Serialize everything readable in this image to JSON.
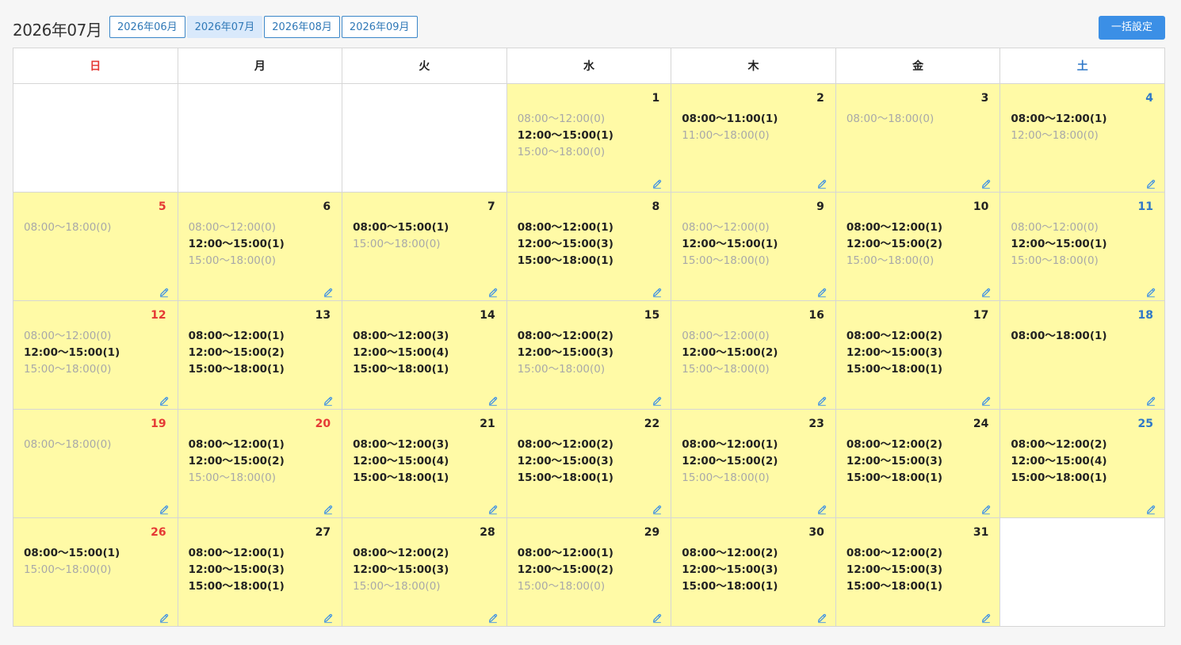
{
  "header": {
    "title": "2026年07月",
    "tabs": [
      {
        "label": "2026年06月",
        "active": false
      },
      {
        "label": "2026年07月",
        "active": true
      },
      {
        "label": "2026年08月",
        "active": false
      },
      {
        "label": "2026年09月",
        "active": false
      }
    ],
    "bulk_button": "一括設定"
  },
  "colors": {
    "day_bg": "#fffaa6",
    "sunday": "#e53935",
    "saturday": "#2f78c8",
    "button": "#3b8fe6",
    "available_text": "#222222",
    "unavailable_text": "#a8a8a8"
  },
  "weekdays": [
    "日",
    "月",
    "火",
    "水",
    "木",
    "金",
    "土"
  ],
  "icons": {
    "edit": "pencil-icon"
  },
  "weeks": [
    [
      null,
      null,
      null,
      {
        "day": "1",
        "slots": [
          {
            "time": "08:00〜12:00(0)",
            "on": false
          },
          {
            "time": "12:00〜15:00(1)",
            "on": true
          },
          {
            "time": "15:00〜18:00(0)",
            "on": false
          }
        ]
      },
      {
        "day": "2",
        "slots": [
          {
            "time": "08:00〜11:00(1)",
            "on": true
          },
          {
            "time": "11:00〜18:00(0)",
            "on": false
          }
        ]
      },
      {
        "day": "3",
        "slots": [
          {
            "time": "08:00〜18:00(0)",
            "on": false
          }
        ]
      },
      {
        "day": "4",
        "slots": [
          {
            "time": "08:00〜12:00(1)",
            "on": true
          },
          {
            "time": "12:00〜18:00(0)",
            "on": false
          }
        ]
      }
    ],
    [
      {
        "day": "5",
        "slots": [
          {
            "time": "08:00〜18:00(0)",
            "on": false
          }
        ]
      },
      {
        "day": "6",
        "slots": [
          {
            "time": "08:00〜12:00(0)",
            "on": false
          },
          {
            "time": "12:00〜15:00(1)",
            "on": true
          },
          {
            "time": "15:00〜18:00(0)",
            "on": false
          }
        ]
      },
      {
        "day": "7",
        "slots": [
          {
            "time": "08:00〜15:00(1)",
            "on": true
          },
          {
            "time": "15:00〜18:00(0)",
            "on": false
          }
        ]
      },
      {
        "day": "8",
        "slots": [
          {
            "time": "08:00〜12:00(1)",
            "on": true
          },
          {
            "time": "12:00〜15:00(3)",
            "on": true
          },
          {
            "time": "15:00〜18:00(1)",
            "on": true
          }
        ]
      },
      {
        "day": "9",
        "slots": [
          {
            "time": "08:00〜12:00(0)",
            "on": false
          },
          {
            "time": "12:00〜15:00(1)",
            "on": true
          },
          {
            "time": "15:00〜18:00(0)",
            "on": false
          }
        ]
      },
      {
        "day": "10",
        "slots": [
          {
            "time": "08:00〜12:00(1)",
            "on": true
          },
          {
            "time": "12:00〜15:00(2)",
            "on": true
          },
          {
            "time": "15:00〜18:00(0)",
            "on": false
          }
        ]
      },
      {
        "day": "11",
        "slots": [
          {
            "time": "08:00〜12:00(0)",
            "on": false
          },
          {
            "time": "12:00〜15:00(1)",
            "on": true
          },
          {
            "time": "15:00〜18:00(0)",
            "on": false
          }
        ]
      }
    ],
    [
      {
        "day": "12",
        "slots": [
          {
            "time": "08:00〜12:00(0)",
            "on": false
          },
          {
            "time": "12:00〜15:00(1)",
            "on": true
          },
          {
            "time": "15:00〜18:00(0)",
            "on": false
          }
        ]
      },
      {
        "day": "13",
        "slots": [
          {
            "time": "08:00〜12:00(1)",
            "on": true
          },
          {
            "time": "12:00〜15:00(2)",
            "on": true
          },
          {
            "time": "15:00〜18:00(1)",
            "on": true
          }
        ]
      },
      {
        "day": "14",
        "slots": [
          {
            "time": "08:00〜12:00(3)",
            "on": true
          },
          {
            "time": "12:00〜15:00(4)",
            "on": true
          },
          {
            "time": "15:00〜18:00(1)",
            "on": true
          }
        ]
      },
      {
        "day": "15",
        "slots": [
          {
            "time": "08:00〜12:00(2)",
            "on": true
          },
          {
            "time": "12:00〜15:00(3)",
            "on": true
          },
          {
            "time": "15:00〜18:00(0)",
            "on": false
          }
        ]
      },
      {
        "day": "16",
        "slots": [
          {
            "time": "08:00〜12:00(0)",
            "on": false
          },
          {
            "time": "12:00〜15:00(2)",
            "on": true
          },
          {
            "time": "15:00〜18:00(0)",
            "on": false
          }
        ]
      },
      {
        "day": "17",
        "slots": [
          {
            "time": "08:00〜12:00(2)",
            "on": true
          },
          {
            "time": "12:00〜15:00(3)",
            "on": true
          },
          {
            "time": "15:00〜18:00(1)",
            "on": true
          }
        ]
      },
      {
        "day": "18",
        "slots": [
          {
            "time": "08:00〜18:00(1)",
            "on": true
          }
        ]
      }
    ],
    [
      {
        "day": "19",
        "slots": [
          {
            "time": "08:00〜18:00(0)",
            "on": false
          }
        ]
      },
      {
        "day": "20",
        "holiday": true,
        "slots": [
          {
            "time": "08:00〜12:00(1)",
            "on": true
          },
          {
            "time": "12:00〜15:00(2)",
            "on": true
          },
          {
            "time": "15:00〜18:00(0)",
            "on": false
          }
        ]
      },
      {
        "day": "21",
        "slots": [
          {
            "time": "08:00〜12:00(3)",
            "on": true
          },
          {
            "time": "12:00〜15:00(4)",
            "on": true
          },
          {
            "time": "15:00〜18:00(1)",
            "on": true
          }
        ]
      },
      {
        "day": "22",
        "slots": [
          {
            "time": "08:00〜12:00(2)",
            "on": true
          },
          {
            "time": "12:00〜15:00(3)",
            "on": true
          },
          {
            "time": "15:00〜18:00(1)",
            "on": true
          }
        ]
      },
      {
        "day": "23",
        "slots": [
          {
            "time": "08:00〜12:00(1)",
            "on": true
          },
          {
            "time": "12:00〜15:00(2)",
            "on": true
          },
          {
            "time": "15:00〜18:00(0)",
            "on": false
          }
        ]
      },
      {
        "day": "24",
        "slots": [
          {
            "time": "08:00〜12:00(2)",
            "on": true
          },
          {
            "time": "12:00〜15:00(3)",
            "on": true
          },
          {
            "time": "15:00〜18:00(1)",
            "on": true
          }
        ]
      },
      {
        "day": "25",
        "slots": [
          {
            "time": "08:00〜12:00(2)",
            "on": true
          },
          {
            "time": "12:00〜15:00(4)",
            "on": true
          },
          {
            "time": "15:00〜18:00(1)",
            "on": true
          }
        ]
      }
    ],
    [
      {
        "day": "26",
        "slots": [
          {
            "time": "08:00〜15:00(1)",
            "on": true
          },
          {
            "time": "15:00〜18:00(0)",
            "on": false
          }
        ]
      },
      {
        "day": "27",
        "slots": [
          {
            "time": "08:00〜12:00(1)",
            "on": true
          },
          {
            "time": "12:00〜15:00(3)",
            "on": true
          },
          {
            "time": "15:00〜18:00(1)",
            "on": true
          }
        ]
      },
      {
        "day": "28",
        "slots": [
          {
            "time": "08:00〜12:00(2)",
            "on": true
          },
          {
            "time": "12:00〜15:00(3)",
            "on": true
          },
          {
            "time": "15:00〜18:00(0)",
            "on": false
          }
        ]
      },
      {
        "day": "29",
        "slots": [
          {
            "time": "08:00〜12:00(1)",
            "on": true
          },
          {
            "time": "12:00〜15:00(2)",
            "on": true
          },
          {
            "time": "15:00〜18:00(0)",
            "on": false
          }
        ]
      },
      {
        "day": "30",
        "slots": [
          {
            "time": "08:00〜12:00(2)",
            "on": true
          },
          {
            "time": "12:00〜15:00(3)",
            "on": true
          },
          {
            "time": "15:00〜18:00(1)",
            "on": true
          }
        ]
      },
      {
        "day": "31",
        "slots": [
          {
            "time": "08:00〜12:00(2)",
            "on": true
          },
          {
            "time": "12:00〜15:00(3)",
            "on": true
          },
          {
            "time": "15:00〜18:00(1)",
            "on": true
          }
        ]
      },
      null
    ]
  ]
}
